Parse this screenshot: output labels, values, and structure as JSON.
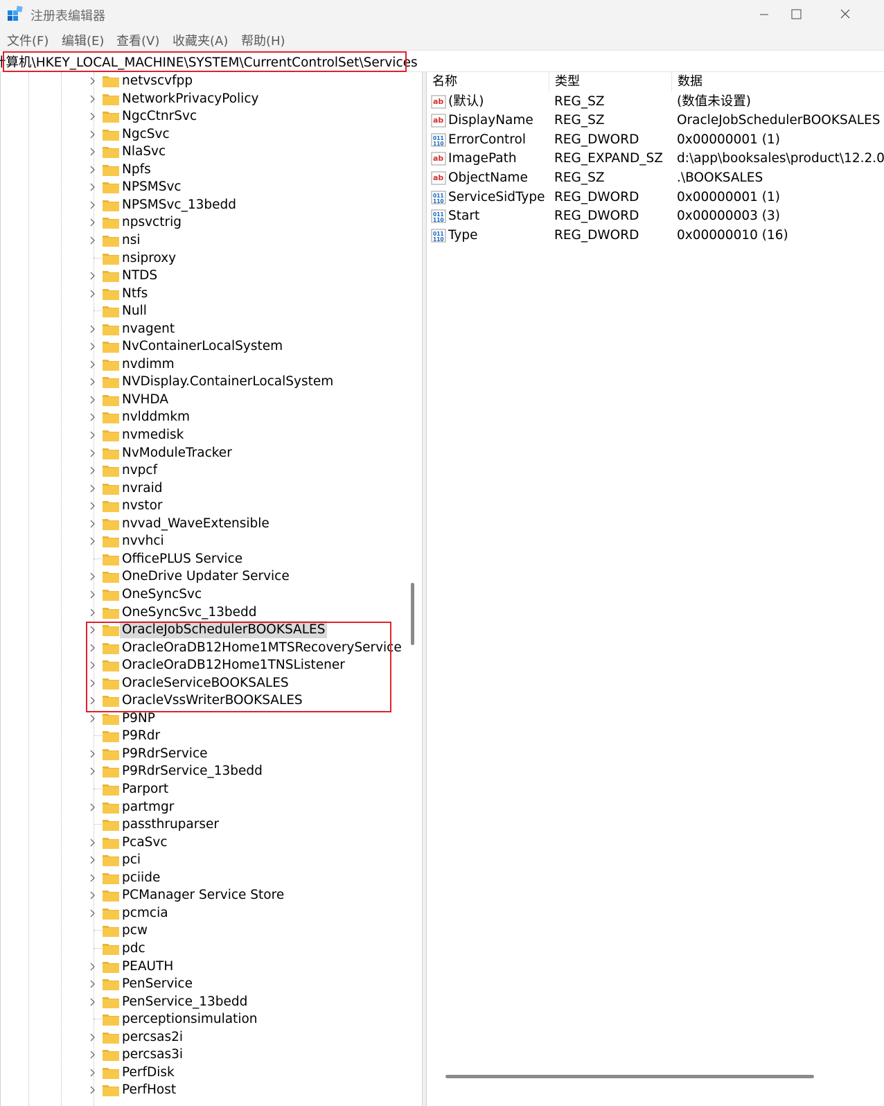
{
  "window": {
    "title": "注册表编辑器"
  },
  "menu": [
    "文件(F)",
    "编辑(E)",
    "查看(V)",
    "收藏夹(A)",
    "帮助(H)"
  ],
  "address": "计算机\\HKEY_LOCAL_MACHINE\\SYSTEM\\CurrentControlSet\\Services",
  "tree": {
    "items": [
      {
        "label": "netvscvfpp",
        "expandable": true
      },
      {
        "label": "NetworkPrivacyPolicy",
        "expandable": true
      },
      {
        "label": "NgcCtnrSvc",
        "expandable": true
      },
      {
        "label": "NgcSvc",
        "expandable": true
      },
      {
        "label": "NlaSvc",
        "expandable": true
      },
      {
        "label": "Npfs",
        "expandable": true
      },
      {
        "label": "NPSMSvc",
        "expandable": true
      },
      {
        "label": "NPSMSvc_13bedd",
        "expandable": true
      },
      {
        "label": "npsvctrig",
        "expandable": true
      },
      {
        "label": "nsi",
        "expandable": true
      },
      {
        "label": "nsiproxy",
        "expandable": false
      },
      {
        "label": "NTDS",
        "expandable": true
      },
      {
        "label": "Ntfs",
        "expandable": true
      },
      {
        "label": "Null",
        "expandable": false
      },
      {
        "label": "nvagent",
        "expandable": true
      },
      {
        "label": "NvContainerLocalSystem",
        "expandable": true
      },
      {
        "label": "nvdimm",
        "expandable": true
      },
      {
        "label": "NVDisplay.ContainerLocalSystem",
        "expandable": true
      },
      {
        "label": "NVHDA",
        "expandable": true
      },
      {
        "label": "nvlddmkm",
        "expandable": true
      },
      {
        "label": "nvmedisk",
        "expandable": true
      },
      {
        "label": "NvModuleTracker",
        "expandable": true
      },
      {
        "label": "nvpcf",
        "expandable": true
      },
      {
        "label": "nvraid",
        "expandable": true
      },
      {
        "label": "nvstor",
        "expandable": true
      },
      {
        "label": "nvvad_WaveExtensible",
        "expandable": true
      },
      {
        "label": "nvvhci",
        "expandable": true
      },
      {
        "label": "OfficePLUS Service",
        "expandable": false
      },
      {
        "label": "OneDrive Updater Service",
        "expandable": true
      },
      {
        "label": "OneSyncSvc",
        "expandable": true
      },
      {
        "label": "OneSyncSvc_13bedd",
        "expandable": true
      },
      {
        "label": "OracleJobSchedulerBOOKSALES",
        "expandable": true,
        "selected": true
      },
      {
        "label": "OracleOraDB12Home1MTSRecoveryService",
        "expandable": true
      },
      {
        "label": "OracleOraDB12Home1TNSListener",
        "expandable": true
      },
      {
        "label": "OracleServiceBOOKSALES",
        "expandable": true
      },
      {
        "label": "OracleVssWriterBOOKSALES",
        "expandable": true
      },
      {
        "label": "P9NP",
        "expandable": true
      },
      {
        "label": "P9Rdr",
        "expandable": false
      },
      {
        "label": "P9RdrService",
        "expandable": true
      },
      {
        "label": "P9RdrService_13bedd",
        "expandable": true
      },
      {
        "label": "Parport",
        "expandable": false
      },
      {
        "label": "partmgr",
        "expandable": true
      },
      {
        "label": "passthruparser",
        "expandable": false
      },
      {
        "label": "PcaSvc",
        "expandable": true
      },
      {
        "label": "pci",
        "expandable": true
      },
      {
        "label": "pciide",
        "expandable": true
      },
      {
        "label": "PCManager Service Store",
        "expandable": true
      },
      {
        "label": "pcmcia",
        "expandable": true
      },
      {
        "label": "pcw",
        "expandable": false
      },
      {
        "label": "pdc",
        "expandable": false
      },
      {
        "label": "PEAUTH",
        "expandable": true
      },
      {
        "label": "PenService",
        "expandable": true
      },
      {
        "label": "PenService_13bedd",
        "expandable": true
      },
      {
        "label": "perceptionsimulation",
        "expandable": false
      },
      {
        "label": "percsas2i",
        "expandable": true
      },
      {
        "label": "percsas3i",
        "expandable": true
      },
      {
        "label": "PerfDisk",
        "expandable": true
      },
      {
        "label": "PerfHost",
        "expandable": true
      }
    ]
  },
  "values": {
    "headers": [
      "名称",
      "类型",
      "数据"
    ],
    "rows": [
      {
        "icon": "string",
        "name": "(默认)",
        "type": "REG_SZ",
        "data": "(数值未设置)"
      },
      {
        "icon": "string",
        "name": "DisplayName",
        "type": "REG_SZ",
        "data": "OracleJobSchedulerBOOKSALES"
      },
      {
        "icon": "binary",
        "name": "ErrorControl",
        "type": "REG_DWORD",
        "data": "0x00000001 (1)"
      },
      {
        "icon": "string",
        "name": "ImagePath",
        "type": "REG_EXPAND_SZ",
        "data": "d:\\app\\booksales\\product\\12.2.0"
      },
      {
        "icon": "string",
        "name": "ObjectName",
        "type": "REG_SZ",
        "data": ".\\BOOKSALES"
      },
      {
        "icon": "binary",
        "name": "ServiceSidType",
        "type": "REG_DWORD",
        "data": "0x00000001 (1)"
      },
      {
        "icon": "binary",
        "name": "Start",
        "type": "REG_DWORD",
        "data": "0x00000003 (3)"
      },
      {
        "icon": "binary",
        "name": "Type",
        "type": "REG_DWORD",
        "data": "0x00000010 (16)"
      }
    ]
  },
  "colors": {
    "highlight": "#e0202b",
    "folder": "#f8c84a",
    "selection": "#d9d9d9"
  }
}
